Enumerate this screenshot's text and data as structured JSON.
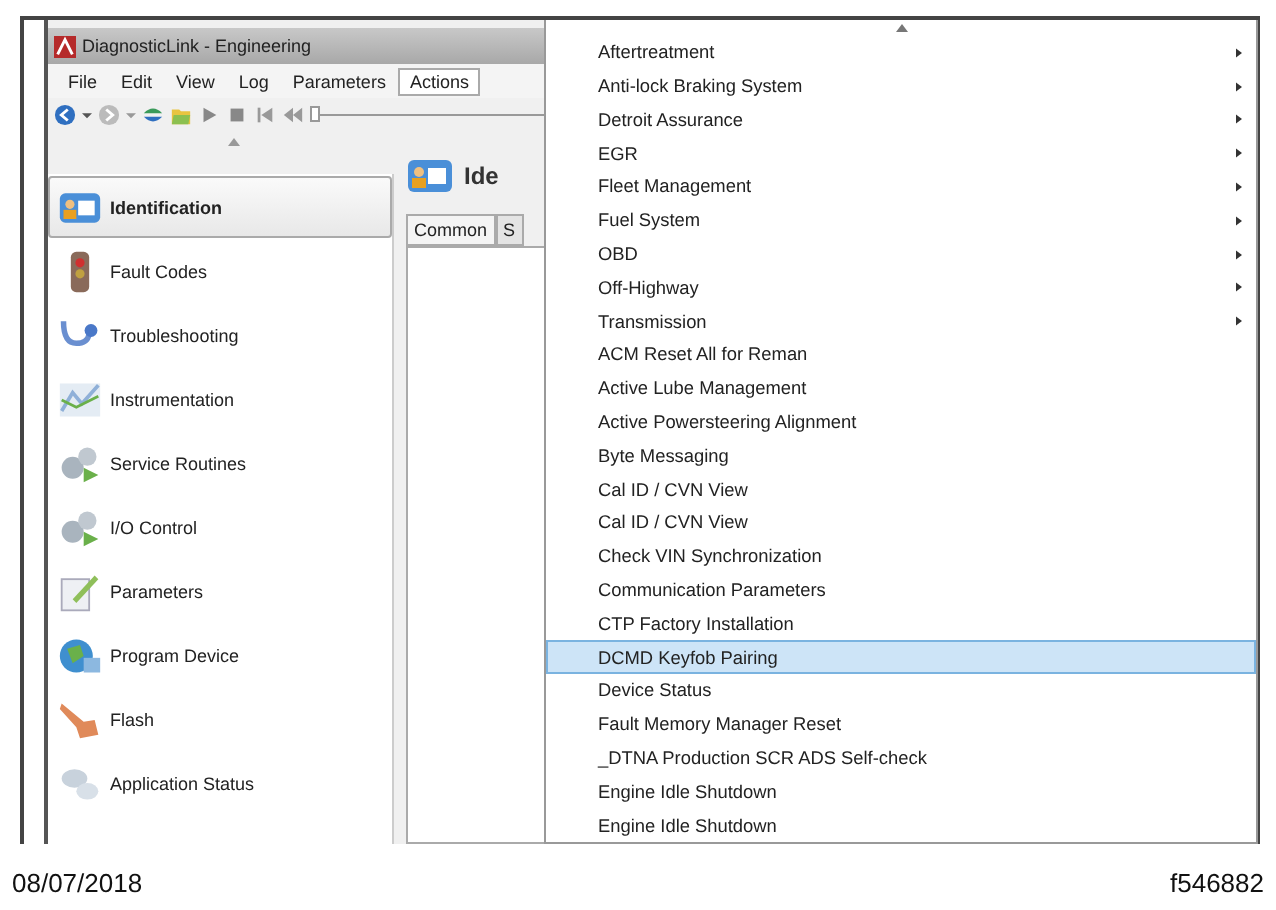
{
  "window": {
    "title": "DiagnosticLink - Engineering"
  },
  "menu_bar": [
    {
      "label": "File",
      "selected": false
    },
    {
      "label": "Edit",
      "selected": false
    },
    {
      "label": "View",
      "selected": false
    },
    {
      "label": "Log",
      "selected": false
    },
    {
      "label": "Parameters",
      "selected": false
    },
    {
      "label": "Actions",
      "selected": true
    }
  ],
  "toolbar": {
    "slider": {
      "level": 0
    }
  },
  "sidebar": {
    "items": [
      {
        "label": "Identification",
        "selected": true
      },
      {
        "label": "Fault Codes",
        "selected": false
      },
      {
        "label": "Troubleshooting",
        "selected": false
      },
      {
        "label": "Instrumentation",
        "selected": false
      },
      {
        "label": "Service Routines",
        "selected": false
      },
      {
        "label": "I/O Control",
        "selected": false
      },
      {
        "label": "Parameters",
        "selected": false
      },
      {
        "label": "Program Device",
        "selected": false
      },
      {
        "label": "Flash",
        "selected": false
      },
      {
        "label": "Application Status",
        "selected": false
      }
    ]
  },
  "content": {
    "heading": "Ide",
    "tabs": [
      {
        "label": "Common",
        "selected": true
      },
      {
        "label": "S",
        "selected": false
      }
    ]
  },
  "context_menu": {
    "items": [
      {
        "label": "Aftertreatment",
        "submenu": true,
        "selected": false
      },
      {
        "label": "Anti-lock Braking System",
        "submenu": true,
        "selected": false
      },
      {
        "label": "Detroit Assurance",
        "submenu": true,
        "selected": false
      },
      {
        "label": "EGR",
        "submenu": true,
        "selected": false
      },
      {
        "label": "Fleet Management",
        "submenu": true,
        "selected": false
      },
      {
        "label": "Fuel System",
        "submenu": true,
        "selected": false
      },
      {
        "label": "OBD",
        "submenu": true,
        "selected": false
      },
      {
        "label": "Off-Highway",
        "submenu": true,
        "selected": false
      },
      {
        "label": "Transmission",
        "submenu": true,
        "selected": false
      },
      {
        "label": "ACM Reset All for Reman",
        "submenu": false,
        "selected": false
      },
      {
        "label": "Active Lube Management",
        "submenu": false,
        "selected": false
      },
      {
        "label": "Active Powersteering Alignment",
        "submenu": false,
        "selected": false
      },
      {
        "label": "Byte Messaging",
        "submenu": false,
        "selected": false
      },
      {
        "label": "Cal ID / CVN View",
        "submenu": false,
        "selected": false
      },
      {
        "label": "Cal ID / CVN View",
        "submenu": false,
        "selected": false
      },
      {
        "label": "Check VIN Synchronization",
        "submenu": false,
        "selected": false
      },
      {
        "label": "Communication Parameters",
        "submenu": false,
        "selected": false
      },
      {
        "label": "CTP Factory Installation",
        "submenu": false,
        "selected": false
      },
      {
        "label": "DCMD Keyfob Pairing",
        "submenu": false,
        "selected": true
      },
      {
        "label": "Device Status",
        "submenu": false,
        "selected": false
      },
      {
        "label": "Fault Memory Manager Reset",
        "submenu": false,
        "selected": false
      },
      {
        "label": "_DTNA Production SCR ADS Self-check",
        "submenu": false,
        "selected": false
      },
      {
        "label": "Engine Idle Shutdown",
        "submenu": false,
        "selected": false
      },
      {
        "label": "Engine Idle Shutdown",
        "submenu": false,
        "selected": false
      }
    ]
  },
  "footer": {
    "date": "08/07/2018",
    "figure_id": "f546882"
  }
}
